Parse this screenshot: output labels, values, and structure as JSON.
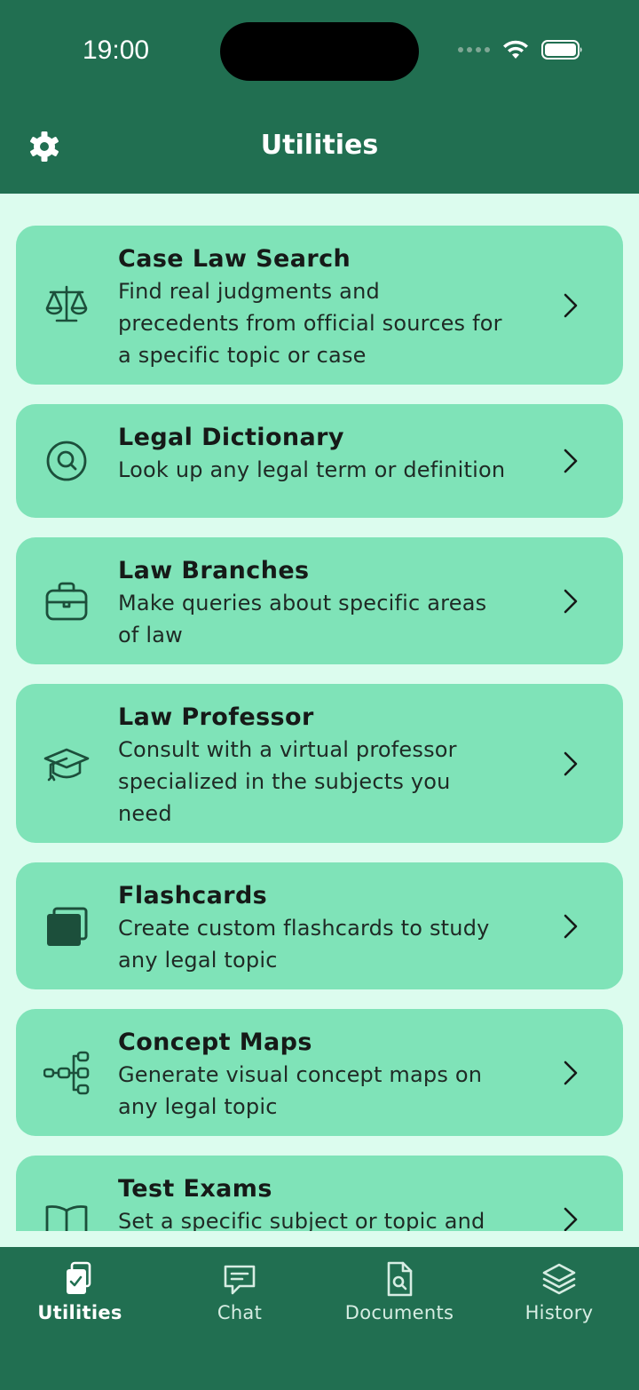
{
  "status": {
    "time": "19:00"
  },
  "header": {
    "title": "Utilities",
    "settings_icon": "gear-icon"
  },
  "utilities": [
    {
      "title": "Case Law Search",
      "desc_lines": [
        "Find real judgments and",
        "precedents from official sources for",
        "a specific topic or case"
      ],
      "icon": "scales-icon"
    },
    {
      "title": "Legal Dictionary",
      "desc_lines": [
        "Look up any legal term or definition"
      ],
      "icon": "search-icon"
    },
    {
      "title": "Law Branches",
      "desc_lines": [
        "Make queries about specific areas",
        "of law"
      ],
      "icon": "briefcase-icon"
    },
    {
      "title": "Law Professor",
      "desc_lines": [
        "Consult with a virtual professor",
        "specialized in the subjects you",
        "need"
      ],
      "icon": "graduation-cap-icon"
    },
    {
      "title": "Flashcards",
      "desc_lines": [
        "Create custom flashcards to study",
        "any legal topic"
      ],
      "icon": "cards-icon"
    },
    {
      "title": "Concept Maps",
      "desc_lines": [
        "Generate visual concept maps on",
        "any legal topic"
      ],
      "icon": "hierarchy-icon"
    },
    {
      "title": "Test Exams",
      "desc_lines": [
        "Set a specific subject or topic and"
      ],
      "icon": "book-icon"
    }
  ],
  "tabs": [
    {
      "label": "Utilities",
      "icon": "utilities-icon",
      "active": true
    },
    {
      "label": "Chat",
      "icon": "chat-icon",
      "active": false
    },
    {
      "label": "Documents",
      "icon": "document-search-icon",
      "active": false
    },
    {
      "label": "History",
      "icon": "layers-icon",
      "active": false
    }
  ],
  "colors": {
    "header": "#216f51",
    "background": "#dcfcee",
    "card": "#7fe3b8",
    "icon": "#1c4f3b"
  }
}
